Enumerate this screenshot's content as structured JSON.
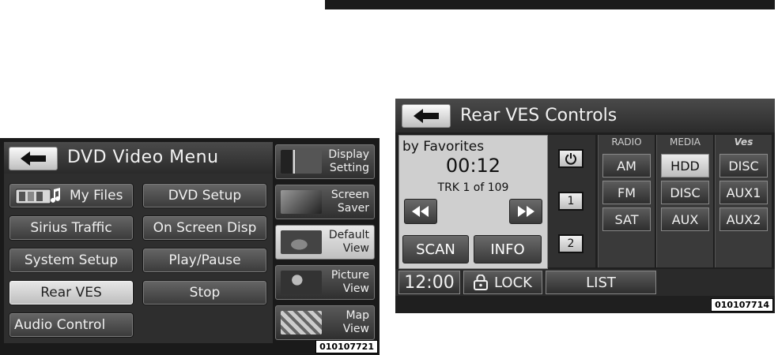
{
  "left_screen": {
    "title": "DVD Video Menu",
    "menu": [
      {
        "label": "My Files",
        "icon": "folder-music-icon",
        "selected": false
      },
      {
        "label": "DVD Setup",
        "selected": false
      },
      {
        "label": "Sirius Traffic",
        "selected": false
      },
      {
        "label": "On Screen Disp",
        "selected": false
      },
      {
        "label": "System Setup",
        "selected": false
      },
      {
        "label": "Play/Pause",
        "selected": false
      },
      {
        "label": "Rear VES",
        "selected": true
      },
      {
        "label": "Stop",
        "selected": false
      },
      {
        "label": "Audio Control",
        "selected": false
      }
    ],
    "side_buttons": [
      {
        "line1": "Display",
        "line2": "Setting",
        "icon": "display-setting-icon",
        "selected": false
      },
      {
        "line1": "Screen",
        "line2": "Saver",
        "icon": "screen-saver-icon",
        "selected": false
      },
      {
        "line1": "Default",
        "line2": "View",
        "icon": "default-view-icon",
        "selected": true
      },
      {
        "line1": "Picture",
        "line2": "View",
        "icon": "picture-view-icon",
        "selected": false
      },
      {
        "line1": "Map",
        "line2": "View",
        "icon": "map-view-icon",
        "selected": false
      }
    ],
    "code": "010107721"
  },
  "right_screen": {
    "title": "Rear VES Controls",
    "info": {
      "mode": "by Favorites",
      "time": "00:12",
      "track": "TRK 1 of 109",
      "scan_label": "SCAN",
      "info_label": "INFO"
    },
    "zones": [
      "1",
      "2"
    ],
    "columns": [
      {
        "header": "RADIO",
        "buttons": [
          {
            "label": "AM",
            "selected": false
          },
          {
            "label": "FM",
            "selected": false
          },
          {
            "label": "SAT",
            "selected": false
          }
        ]
      },
      {
        "header": "MEDIA",
        "buttons": [
          {
            "label": "HDD",
            "selected": true
          },
          {
            "label": "DISC",
            "selected": false
          },
          {
            "label": "AUX",
            "selected": false
          }
        ]
      },
      {
        "header": "Ves",
        "buttons": [
          {
            "label": "DISC",
            "selected": false
          },
          {
            "label": "AUX1",
            "selected": false
          },
          {
            "label": "AUX2",
            "selected": false
          }
        ]
      }
    ],
    "bottom": {
      "clock": "12:00",
      "lock_label": "LOCK",
      "list_label": "LIST"
    },
    "code": "010107714"
  }
}
